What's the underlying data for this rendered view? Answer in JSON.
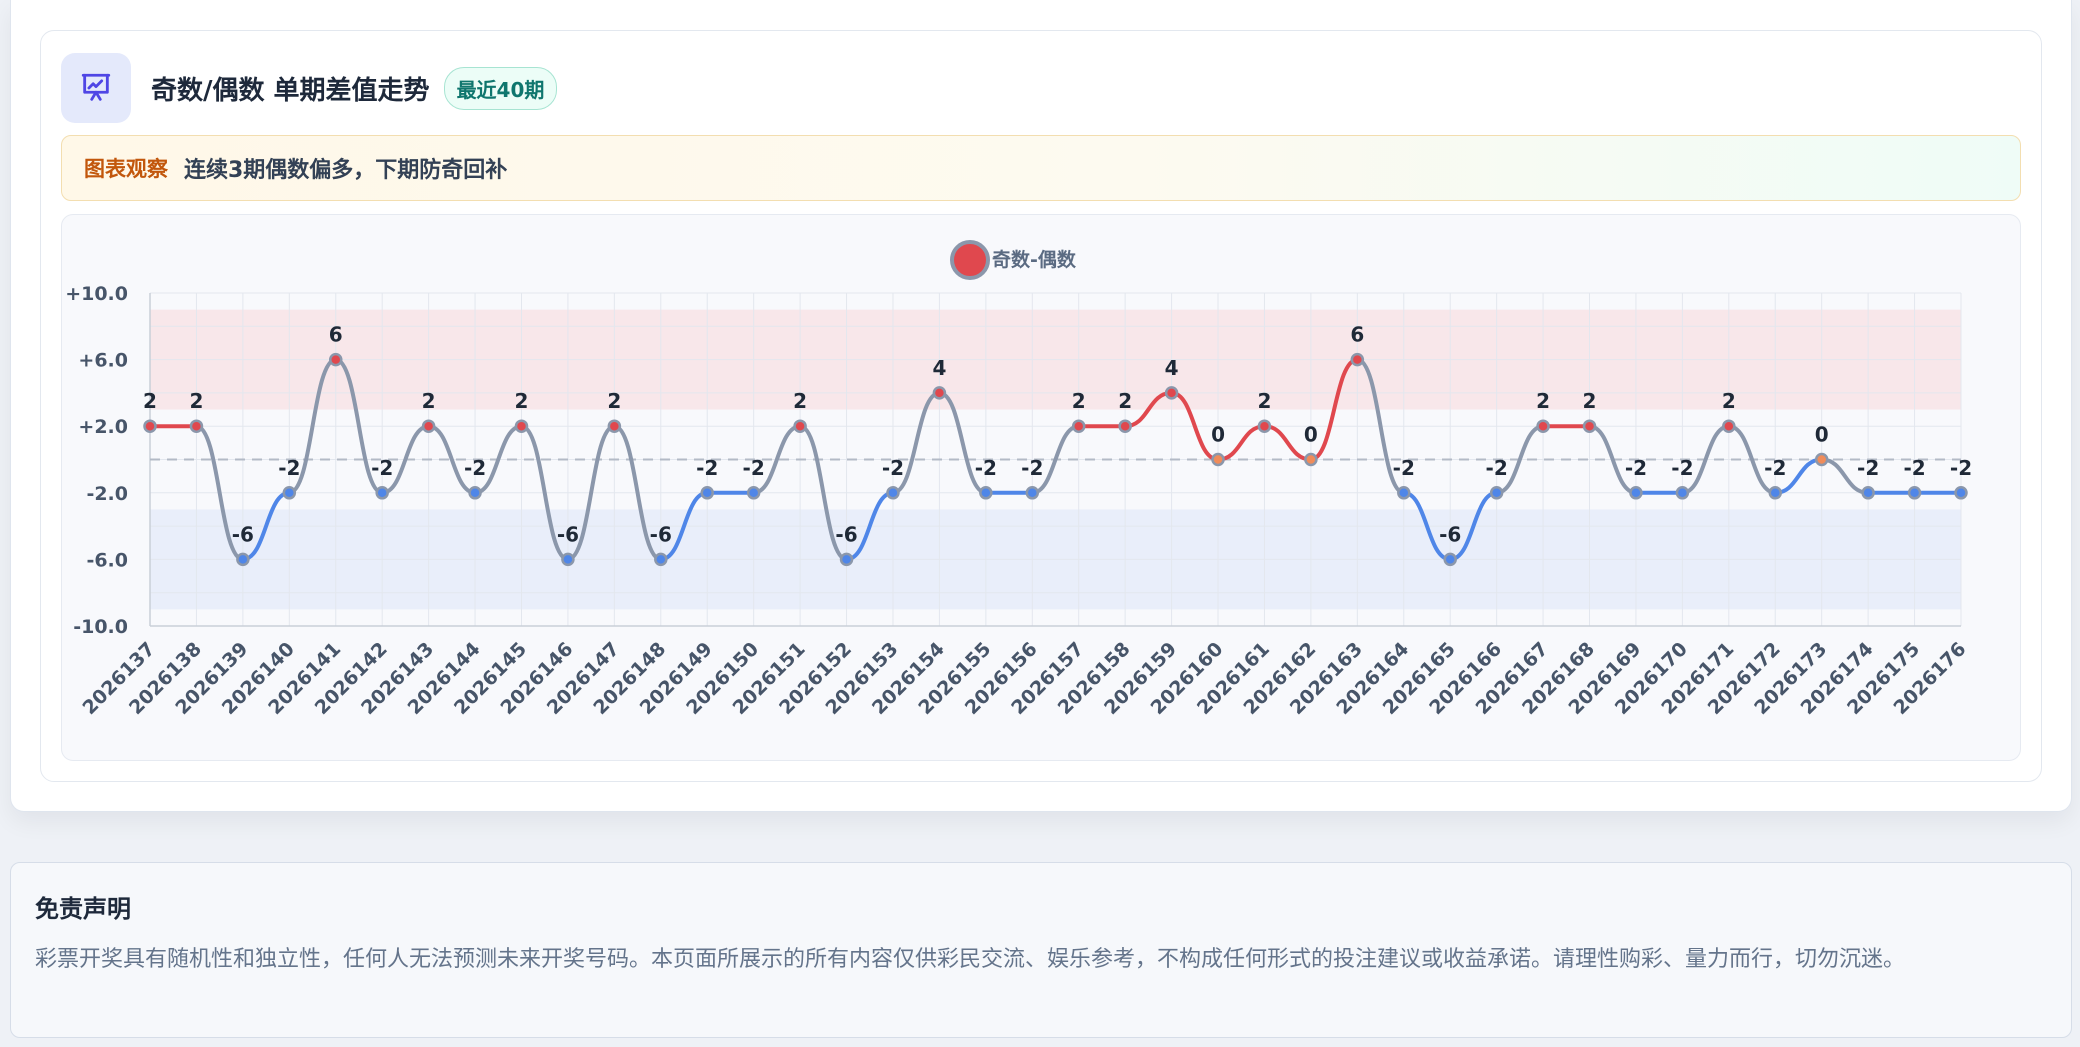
{
  "header": {
    "icon": "presentation-chart-icon",
    "title": "奇数/偶数 单期差值走势",
    "badge": "最近40期"
  },
  "observation": {
    "label": "图表观察",
    "text": "连续3期偶数偏多，下期防奇回补"
  },
  "disclaimer": {
    "title": "免责声明",
    "text": "彩票开奖具有随机性和独立性，任何人无法预测未来开奖号码。本页面所展示的所有内容仅供彩民交流、娱乐参考，不构成任何形式的投注建议或收益承诺。请理性购彩、量力而行，切勿沉迷。"
  },
  "colors": {
    "positive": "#e0484e",
    "negative": "#4f86e8",
    "neutral": "#8b97ab",
    "positive_band": "#f8e7ea",
    "negative_band": "#e9eefa"
  },
  "chart_data": {
    "type": "line",
    "legend_position": "top-center",
    "grid": true,
    "ylim": [
      -10,
      10
    ],
    "yticks": [
      {
        "value": 10,
        "label": "+10.0"
      },
      {
        "value": 6,
        "label": "+6.0"
      },
      {
        "value": 2,
        "label": "+2.0"
      },
      {
        "value": -2,
        "label": "-2.0"
      },
      {
        "value": -6,
        "label": "-6.0"
      },
      {
        "value": -10,
        "label": "-10.0"
      }
    ],
    "reference_line": 0,
    "bands": [
      {
        "from": 3,
        "to": 9,
        "tone": "positive"
      },
      {
        "from": -9,
        "to": -3,
        "tone": "negative"
      }
    ],
    "categories": [
      "2026137",
      "2026138",
      "2026139",
      "2026140",
      "2026141",
      "2026142",
      "2026143",
      "2026144",
      "2026145",
      "2026146",
      "2026147",
      "2026148",
      "2026149",
      "2026150",
      "2026151",
      "2026152",
      "2026153",
      "2026154",
      "2026155",
      "2026156",
      "2026157",
      "2026158",
      "2026159",
      "2026160",
      "2026161",
      "2026162",
      "2026163",
      "2026164",
      "2026165",
      "2026166",
      "2026167",
      "2026168",
      "2026169",
      "2026170",
      "2026171",
      "2026172",
      "2026173",
      "2026174",
      "2026175",
      "2026176"
    ],
    "series": [
      {
        "name": "奇数-偶数",
        "values": [
          2,
          2,
          -6,
          -2,
          6,
          -2,
          2,
          -2,
          2,
          -6,
          2,
          -6,
          -2,
          -2,
          2,
          -6,
          -2,
          4,
          -2,
          -2,
          2,
          2,
          4,
          0,
          2,
          0,
          6,
          -2,
          -6,
          -2,
          2,
          2,
          -2,
          -2,
          2,
          -2,
          0,
          -2,
          -2,
          -2
        ]
      }
    ]
  }
}
